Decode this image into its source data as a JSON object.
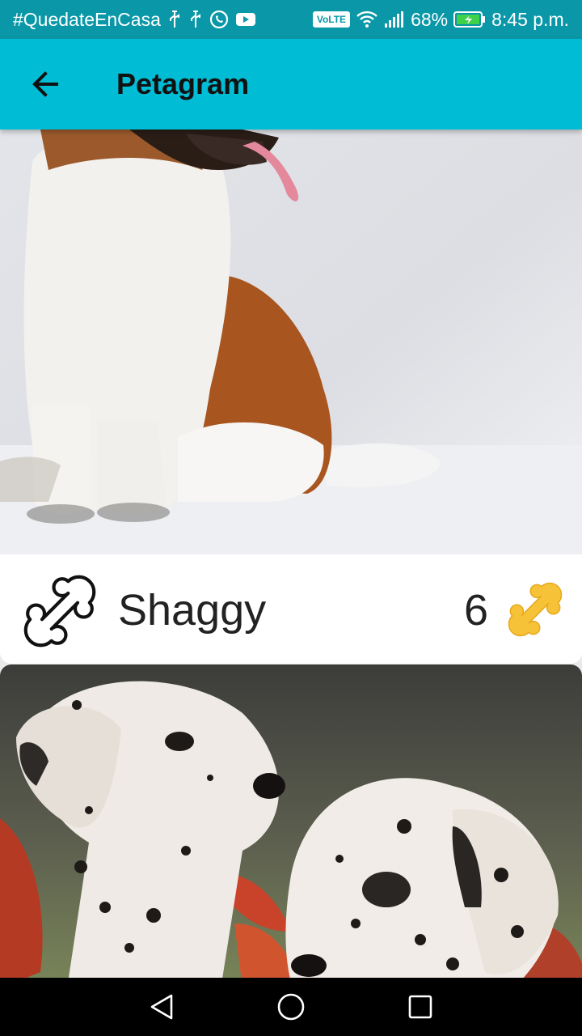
{
  "status_bar": {
    "hashtag": "#QuedateEnCasa",
    "volte": "VoLTE",
    "battery_percent": "68%",
    "time": "8:45 p.m.",
    "icons": [
      "usb-icon",
      "usb-icon",
      "whatsapp-icon",
      "youtube-icon",
      "volte-icon",
      "wifi-icon",
      "signal-icon",
      "battery-charging-icon"
    ]
  },
  "app_bar": {
    "title": "Petagram",
    "back_icon": "arrow-back-icon",
    "color": "#00bcd4"
  },
  "pets": [
    {
      "name": "Shaggy",
      "likes": "6",
      "photo": "st-bernard-dog",
      "like_icon": "bone-outline-icon",
      "rating_icon": "bone-filled-icon"
    },
    {
      "photo": "dalmatian-puppies"
    }
  ],
  "colors": {
    "status_bar": "#0a97a8",
    "accent_bone": "#f6c338"
  },
  "nav_bar": {
    "buttons": [
      "back-triangle-icon",
      "home-circle-icon",
      "recents-square-icon"
    ]
  }
}
